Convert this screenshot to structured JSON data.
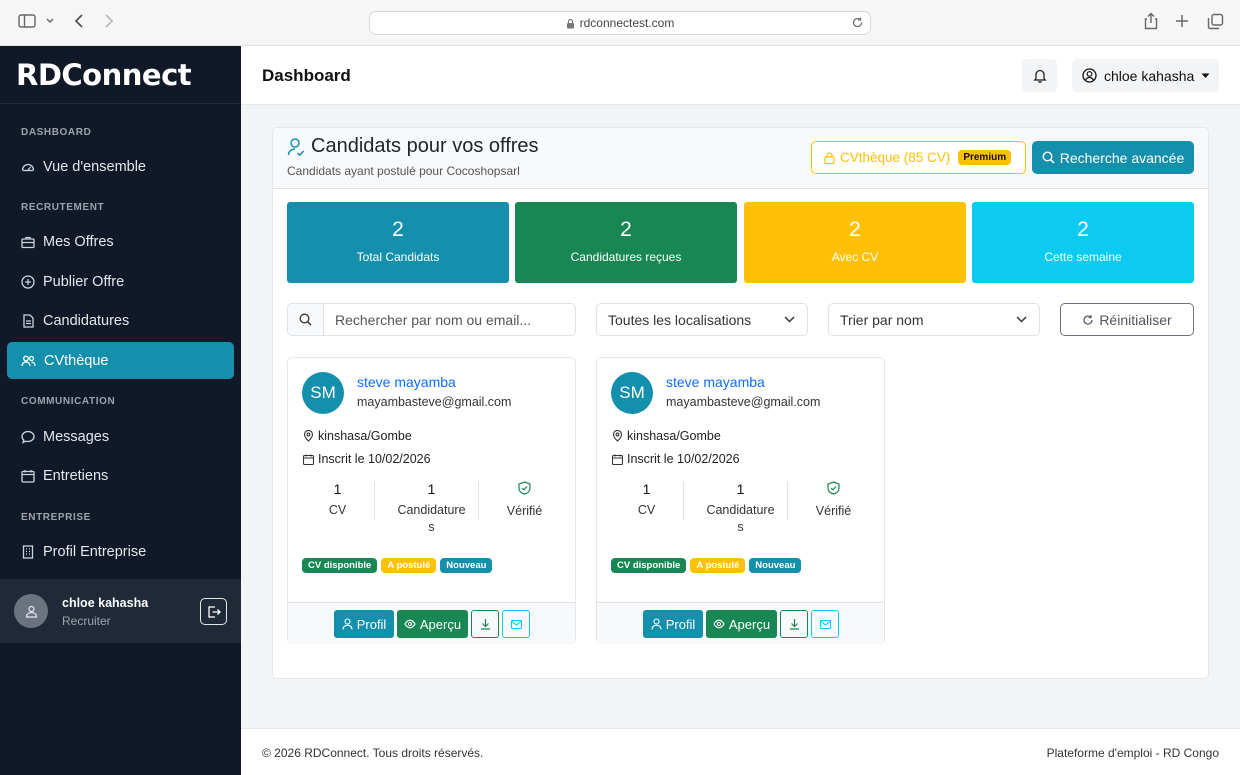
{
  "browser": {
    "url": "rdconnectest.com"
  },
  "brand": {
    "name": "RDConnect"
  },
  "sidebar": {
    "sections": [
      "DASHBOARD",
      "RECRUTEMENT",
      "COMMUNICATION",
      "ENTREPRISE"
    ],
    "items": [
      {
        "label": "Vue d'ensemble",
        "icon": "gauge-icon"
      },
      {
        "label": "Mes Offres",
        "icon": "briefcase-icon"
      },
      {
        "label": "Publier Offre",
        "icon": "plus-circle-icon"
      },
      {
        "label": "Candidatures",
        "icon": "document-icon"
      },
      {
        "label": "CVthèque",
        "icon": "people-icon",
        "active": true
      },
      {
        "label": "Messages",
        "icon": "chat-icon"
      },
      {
        "label": "Entretiens",
        "icon": "calendar-icon"
      },
      {
        "label": "Profil Entreprise",
        "icon": "building-icon"
      }
    ],
    "user": {
      "name": "chloe kahasha",
      "role": "Recruiter"
    }
  },
  "topbar": {
    "title": "Dashboard",
    "user": "chloe kahasha"
  },
  "card": {
    "title": "Candidats pour vos offres",
    "subtitle": "Candidats ayant postulé pour Cocoshopsarl",
    "cvtheque_label": "CVthèque (85 CV)",
    "premium_label": "Premium",
    "advanced_search_label": "Recherche avancée",
    "colors": {
      "accent": "#1590ac",
      "warning": "#ffc107",
      "success": "#198754",
      "info": "#0dcaf0"
    }
  },
  "stats": [
    {
      "value": "2",
      "label": "Total Candidats",
      "color": "#1590ac"
    },
    {
      "value": "2",
      "label": "Candidatures reçues",
      "color": "#198754"
    },
    {
      "value": "2",
      "label": "Avec CV",
      "color": "#ffc107"
    },
    {
      "value": "2",
      "label": "Cette semaine",
      "color": "#0dcaf0"
    }
  ],
  "filters": {
    "search_placeholder": "Rechercher par nom ou email...",
    "location": "Toutes les localisations",
    "sort": "Trier par nom",
    "reset_label": "Réinitialiser"
  },
  "candidates": [
    {
      "initials": "SM",
      "name": "steve mayamba",
      "email": "mayambasteve@gmail.com",
      "location": "kinshasa/Gombe",
      "registered": "Inscrit le 10/02/2026",
      "cv_count": "1",
      "cv_label": "CV",
      "applications_count": "1",
      "applications_label": "Candidature",
      "applications_label_wrap": "s",
      "verified_label": "Vérifié",
      "badges": [
        "CV disponible",
        "A postulé",
        "Nouveau"
      ],
      "profile_label": "Profil",
      "preview_label": "Aperçu"
    },
    {
      "initials": "SM",
      "name": "steve mayamba",
      "email": "mayambasteve@gmail.com",
      "location": "kinshasa/Gombe",
      "registered": "Inscrit le 10/02/2026",
      "cv_count": "1",
      "cv_label": "CV",
      "applications_count": "1",
      "applications_label": "Candidature",
      "applications_label_wrap": "s",
      "verified_label": "Vérifié",
      "badges": [
        "CV disponible",
        "A postulé",
        "Nouveau"
      ],
      "profile_label": "Profil",
      "preview_label": "Aperçu"
    }
  ],
  "footer": {
    "left": "© 2026 RDConnect. Tous droits réservés.",
    "right": "Plateforme d'emploi - RD Congo"
  }
}
